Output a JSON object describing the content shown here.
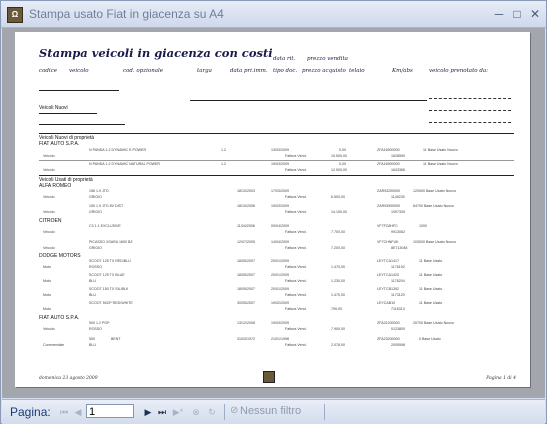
{
  "window": {
    "title": "Stampa usato Fiat in giacenza su A4"
  },
  "report": {
    "title": "Stampa veicoli in giacenza con costi",
    "headers_top": {
      "data_rit": "data rit.",
      "prezzo_vendita": "prezzo vendita"
    },
    "headers": {
      "codice": "codice",
      "veicolo": "veicolo",
      "cod_opzionale": "cod. opzionale",
      "targa": "targa",
      "data_pri_immat": "data pri.imm.",
      "tipo_doc": "tipo doc.",
      "prezzo_acquisto": "prezzo acquisto",
      "telaio": "telaio",
      "km": "Km/abs",
      "veicolo_prenotato": "veicolo prenotato da:"
    },
    "sections": [
      {
        "label": "Veicoli Nuovi"
      },
      {
        "label": "Veicoli Nuovi di proprietà"
      },
      {
        "label": "FIAT AUTO S.P.A."
      },
      {
        "label": "Veicoli Usati di proprietà"
      },
      {
        "label": "ALFA ROMEO"
      },
      {
        "label": "CITROEN"
      },
      {
        "label": "DODGE MOTORS"
      },
      {
        "label": "FIAT AUTO S.P.A."
      }
    ],
    "footer_left": "domenica 23 agosto 2009",
    "footer_right": "Pagina 1 di 4"
  },
  "navigation": {
    "label": "Pagina:",
    "page_value": "1",
    "filter_label": "Nessun filtro"
  },
  "icons": {
    "app": "app-icon",
    "minimize": "minimize-icon",
    "maximize": "maximize-icon",
    "close": "close-icon"
  }
}
